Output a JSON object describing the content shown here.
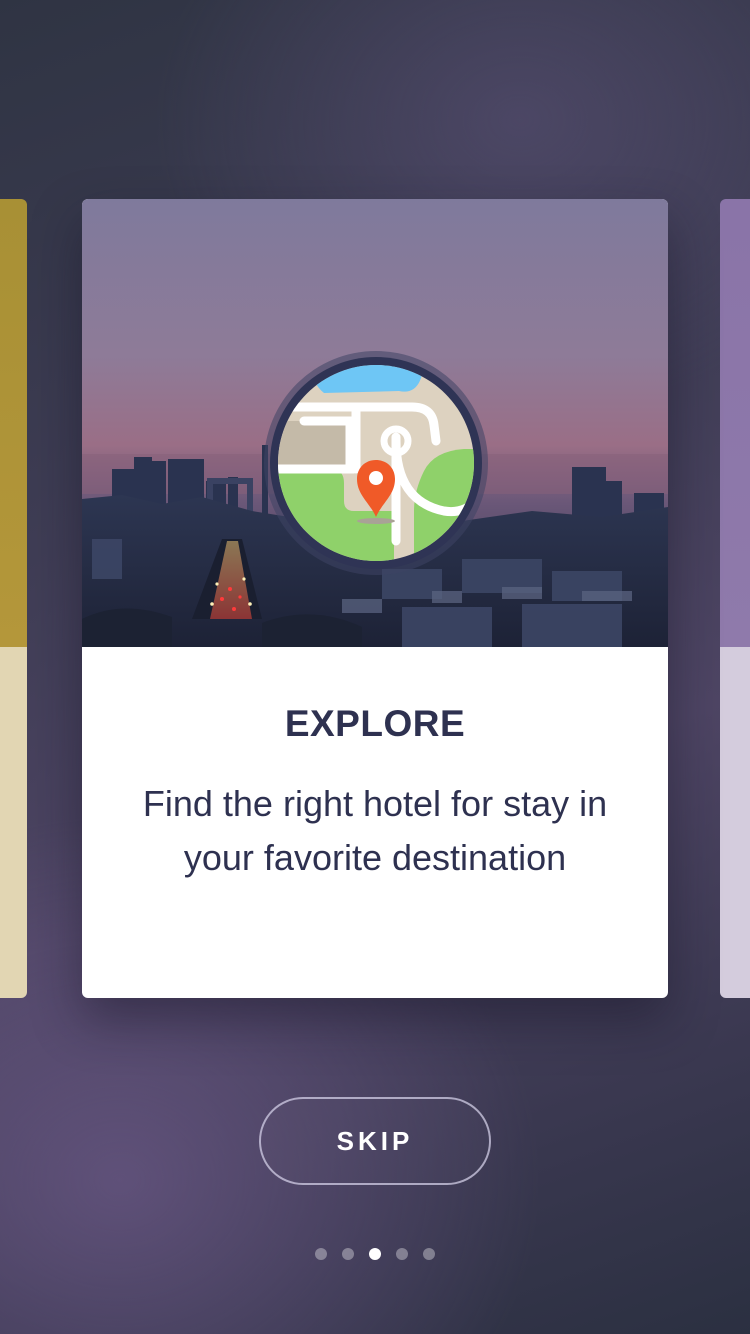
{
  "card": {
    "title": "EXPLORE",
    "description": "Find the right hotel for stay in your favorite destination"
  },
  "skip_label": "SKIP",
  "pagination": {
    "total": 5,
    "active_index": 2
  },
  "colors": {
    "title_text": "#2e3150",
    "pin": "#f05a28",
    "map_water": "#6ec6f5",
    "map_park": "#8fd16a",
    "map_land": "#ddd2c0"
  },
  "icons": {
    "map_badge": "map-pin-icon"
  }
}
